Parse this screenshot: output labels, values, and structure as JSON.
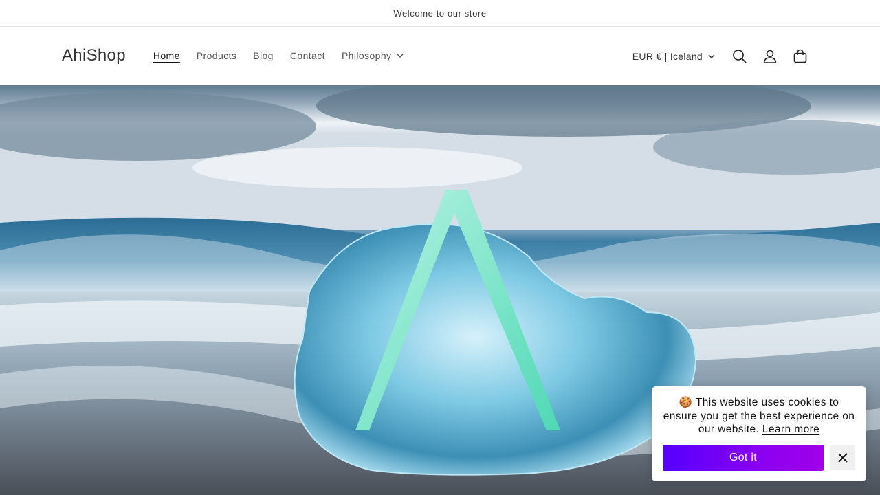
{
  "announcement": {
    "text": "Welcome to our store"
  },
  "header": {
    "logo": "AhiShop",
    "nav": [
      {
        "label": "Home",
        "active": true
      },
      {
        "label": "Products"
      },
      {
        "label": "Blog"
      },
      {
        "label": "Contact"
      },
      {
        "label": "Philosophy",
        "has_dropdown": true
      }
    ],
    "locale": "EUR € | Iceland",
    "icons": [
      "chevron-down-icon",
      "search-icon",
      "account-icon",
      "cart-icon"
    ]
  },
  "hero": {
    "image": "ice-on-black-sand-beach-with-teal-A-logo"
  },
  "cookie_banner": {
    "emoji": "🍪",
    "message": "This website uses cookies to ensure you get the best experience on our website.",
    "learn_more": "Learn more",
    "accept_label": "Got it",
    "accept_colors": [
      "#5500ff",
      "#a000e8"
    ]
  },
  "colors": {
    "text": "#121212",
    "muted": "#555555",
    "logo_accent": "#5fd8b8"
  }
}
